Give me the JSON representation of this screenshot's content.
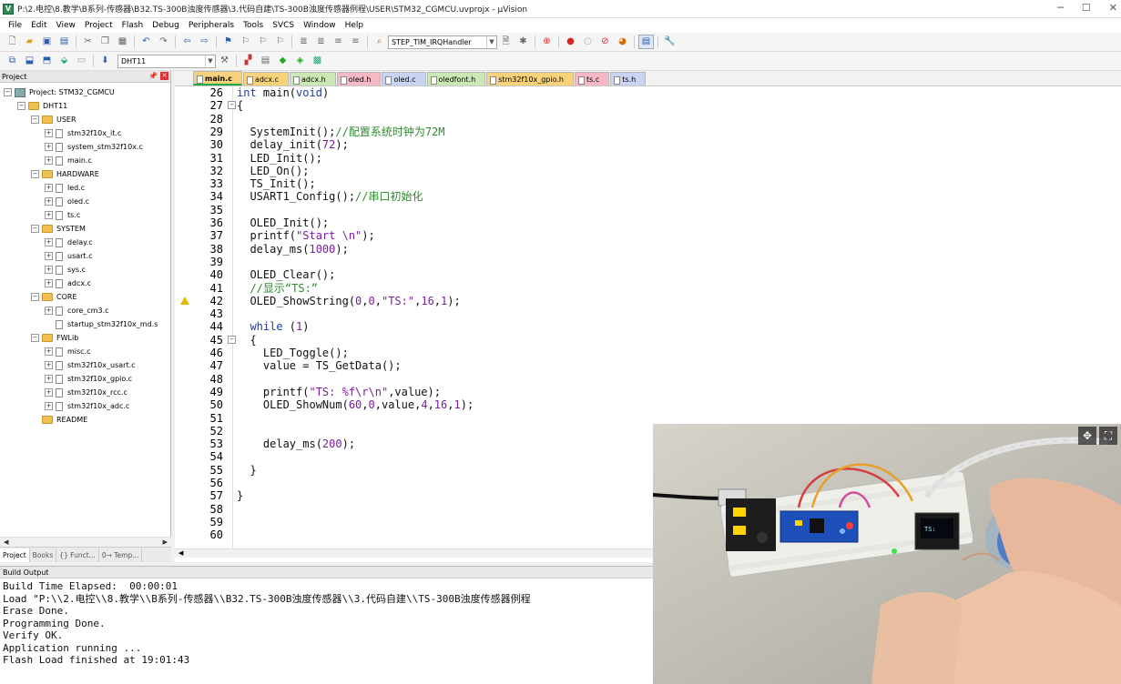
{
  "window": {
    "title": "P:\\2.电控\\8.教学\\B系列-传感器\\B32.TS-300B浊度传感器\\3.代码自建\\TS-300B浊度传感器例程\\USER\\STM32_CGMCU.uvprojx - µVision",
    "app_icon": "V"
  },
  "menu": [
    "File",
    "Edit",
    "View",
    "Project",
    "Flash",
    "Debug",
    "Peripherals",
    "Tools",
    "SVCS",
    "Window",
    "Help"
  ],
  "toolbar1": {
    "function_combo": "STEP_TIM_IRQHandler"
  },
  "toolbar2": {
    "target_combo": "DHT11"
  },
  "project_panel": {
    "title": "Project",
    "tree": [
      {
        "level": 0,
        "type": "project",
        "label": "Project: STM32_CGMCU",
        "expander": "−"
      },
      {
        "level": 1,
        "type": "target",
        "label": "DHT11",
        "expander": "−"
      },
      {
        "level": 2,
        "type": "folder",
        "label": "USER",
        "expander": "−"
      },
      {
        "level": 3,
        "type": "file",
        "label": "stm32f10x_it.c",
        "expander": "+"
      },
      {
        "level": 3,
        "type": "file",
        "label": "system_stm32f10x.c",
        "expander": "+"
      },
      {
        "level": 3,
        "type": "file",
        "label": "main.c",
        "expander": "+"
      },
      {
        "level": 2,
        "type": "folder",
        "label": "HARDWARE",
        "expander": "−"
      },
      {
        "level": 3,
        "type": "file",
        "label": "led.c",
        "expander": "+"
      },
      {
        "level": 3,
        "type": "file",
        "label": "oled.c",
        "expander": "+"
      },
      {
        "level": 3,
        "type": "file",
        "label": "ts.c",
        "expander": "+"
      },
      {
        "level": 2,
        "type": "folder",
        "label": "SYSTEM",
        "expander": "−"
      },
      {
        "level": 3,
        "type": "file",
        "label": "delay.c",
        "expander": "+"
      },
      {
        "level": 3,
        "type": "file",
        "label": "usart.c",
        "expander": "+"
      },
      {
        "level": 3,
        "type": "file",
        "label": "sys.c",
        "expander": "+"
      },
      {
        "level": 3,
        "type": "file",
        "label": "adcx.c",
        "expander": "+"
      },
      {
        "level": 2,
        "type": "folder",
        "label": "CORE",
        "expander": "−"
      },
      {
        "level": 3,
        "type": "file",
        "label": "core_cm3.c",
        "expander": "+"
      },
      {
        "level": 3,
        "type": "file",
        "label": "startup_stm32f10x_md.s",
        "expander": ""
      },
      {
        "level": 2,
        "type": "folder",
        "label": "FWLib",
        "expander": "−"
      },
      {
        "level": 3,
        "type": "file",
        "label": "misc.c",
        "expander": "+"
      },
      {
        "level": 3,
        "type": "file",
        "label": "stm32f10x_usart.c",
        "expander": "+"
      },
      {
        "level": 3,
        "type": "file",
        "label": "stm32f10x_gpio.c",
        "expander": "+"
      },
      {
        "level": 3,
        "type": "file",
        "label": "stm32f10x_rcc.c",
        "expander": "+"
      },
      {
        "level": 3,
        "type": "file",
        "label": "stm32f10x_adc.c",
        "expander": "+"
      },
      {
        "level": 2,
        "type": "folder",
        "label": "README",
        "expander": ""
      }
    ],
    "bottom_tabs": [
      "Project",
      "Books",
      "{} Funct...",
      "0→ Temp..."
    ]
  },
  "editor": {
    "tabs": [
      {
        "label": "main.c",
        "color": "#f7d27a",
        "active": true
      },
      {
        "label": "adcx.c",
        "color": "#f7d27a"
      },
      {
        "label": "adcx.h",
        "color": "#c9e8b4"
      },
      {
        "label": "oled.h",
        "color": "#f6b8c4"
      },
      {
        "label": "oled.c",
        "color": "#c8d4f2"
      },
      {
        "label": "oledfont.h",
        "color": "#c9e8b4"
      },
      {
        "label": "stm32f10x_gpio.h",
        "color": "#f7d27a"
      },
      {
        "label": "ts.c",
        "color": "#f6b8c4"
      },
      {
        "label": "ts.h",
        "color": "#c8d4f2"
      }
    ],
    "lines": [
      {
        "n": "26",
        "parts": [
          [
            "k",
            "int"
          ],
          [
            "t",
            " main("
          ],
          [
            "k",
            "void"
          ],
          [
            "t",
            ")"
          ]
        ]
      },
      {
        "n": "27",
        "fold": "−",
        "parts": [
          [
            "t",
            "{"
          ]
        ]
      },
      {
        "n": "28",
        "parts": []
      },
      {
        "n": "29",
        "parts": [
          [
            "t",
            "  SystemInit();"
          ],
          [
            "cm",
            "//配置系统时钟为72M"
          ]
        ]
      },
      {
        "n": "30",
        "parts": [
          [
            "t",
            "  delay_init("
          ],
          [
            "n",
            "72"
          ],
          [
            "t",
            ");"
          ]
        ]
      },
      {
        "n": "31",
        "parts": [
          [
            "t",
            "  LED_Init();"
          ]
        ]
      },
      {
        "n": "32",
        "parts": [
          [
            "t",
            "  LED_On();"
          ]
        ]
      },
      {
        "n": "33",
        "parts": [
          [
            "t",
            "  TS_Init();"
          ]
        ]
      },
      {
        "n": "34",
        "parts": [
          [
            "t",
            "  USART1_Config();"
          ],
          [
            "cm",
            "//串口初始化"
          ]
        ]
      },
      {
        "n": "35",
        "parts": []
      },
      {
        "n": "36",
        "parts": [
          [
            "t",
            "  OLED_Init();"
          ]
        ]
      },
      {
        "n": "37",
        "parts": [
          [
            "t",
            "  printf("
          ],
          [
            "s",
            "\"Start \\n\""
          ],
          [
            "t",
            ");"
          ]
        ]
      },
      {
        "n": "38",
        "parts": [
          [
            "t",
            "  delay_ms("
          ],
          [
            "n",
            "1000"
          ],
          [
            "t",
            ");"
          ]
        ]
      },
      {
        "n": "39",
        "parts": []
      },
      {
        "n": "40",
        "parts": [
          [
            "t",
            "  OLED_Clear();"
          ]
        ]
      },
      {
        "n": "41",
        "parts": [
          [
            "cm",
            "  //显示“TS:”"
          ]
        ]
      },
      {
        "n": "42",
        "warn": true,
        "parts": [
          [
            "t",
            "  OLED_ShowString("
          ],
          [
            "n",
            "0"
          ],
          [
            "t",
            ","
          ],
          [
            "n",
            "0"
          ],
          [
            "t",
            ","
          ],
          [
            "s",
            "\"TS:\""
          ],
          [
            "t",
            ","
          ],
          [
            "n",
            "16"
          ],
          [
            "t",
            ","
          ],
          [
            "n",
            "1"
          ],
          [
            "t",
            ");"
          ]
        ]
      },
      {
        "n": "43",
        "parts": []
      },
      {
        "n": "44",
        "parts": [
          [
            "k",
            "  while"
          ],
          [
            "t",
            " ("
          ],
          [
            "n",
            "1"
          ],
          [
            "t",
            ")"
          ]
        ]
      },
      {
        "n": "45",
        "fold": "−",
        "parts": [
          [
            "t",
            "  {"
          ]
        ]
      },
      {
        "n": "46",
        "parts": [
          [
            "t",
            "    LED_Toggle();"
          ]
        ]
      },
      {
        "n": "47",
        "parts": [
          [
            "t",
            "    value = TS_GetData();"
          ]
        ]
      },
      {
        "n": "48",
        "parts": []
      },
      {
        "n": "49",
        "parts": [
          [
            "t",
            "    printf("
          ],
          [
            "s",
            "\"TS: %f\\r\\n\""
          ],
          [
            "t",
            ",value);"
          ]
        ]
      },
      {
        "n": "50",
        "parts": [
          [
            "t",
            "    OLED_ShowNum("
          ],
          [
            "n",
            "60"
          ],
          [
            "t",
            ","
          ],
          [
            "n",
            "0"
          ],
          [
            "t",
            ",value,"
          ],
          [
            "n",
            "4"
          ],
          [
            "t",
            ","
          ],
          [
            "n",
            "16"
          ],
          [
            "t",
            ","
          ],
          [
            "n",
            "1"
          ],
          [
            "t",
            ");"
          ]
        ]
      },
      {
        "n": "51",
        "parts": []
      },
      {
        "n": "52",
        "parts": []
      },
      {
        "n": "53",
        "parts": [
          [
            "t",
            "    delay_ms("
          ],
          [
            "n",
            "200"
          ],
          [
            "t",
            ");"
          ]
        ]
      },
      {
        "n": "54",
        "parts": []
      },
      {
        "n": "55",
        "parts": [
          [
            "t",
            "  }"
          ]
        ]
      },
      {
        "n": "56",
        "parts": []
      },
      {
        "n": "57",
        "parts": [
          [
            "t",
            "}"
          ]
        ]
      },
      {
        "n": "58",
        "parts": []
      },
      {
        "n": "59",
        "parts": []
      },
      {
        "n": "60",
        "parts": []
      }
    ]
  },
  "build_output": {
    "title": "Build Output",
    "lines": [
      "Build Time Elapsed:  00:00:01",
      "Load \"P:\\\\2.电控\\\\8.教学\\\\B系列-传感器\\\\B32.TS-300B浊度传感器\\\\3.代码自建\\\\TS-300B浊度传感器例程",
      "Erase Done.",
      "Programming Done.",
      "Verify OK.",
      "Application running ...",
      "Flash Load finished at 19:01:43"
    ]
  },
  "video_overlay": {
    "controls": [
      "move-icon",
      "fullscreen-icon"
    ]
  }
}
